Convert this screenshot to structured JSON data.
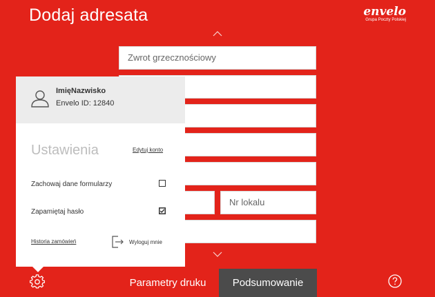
{
  "header": {
    "title": "Dodaj adresata",
    "logo_main": "envelo",
    "logo_sub": "Grupa Poczty Polskiej"
  },
  "form": {
    "title_placeholder": "Zwrot grzecznościowy",
    "apartment_placeholder": "Nr lokalu"
  },
  "settings_panel": {
    "user_name": "ImięNazwisko",
    "envelo_id": "Envelo ID: 12840",
    "title": "Ustawienia",
    "edit_account": "Edytuj konto",
    "option_keep_form": "Zachowaj dane formularzy",
    "option_keep_form_checked": false,
    "option_remember_password": "Zapamiętaj hasło",
    "option_remember_password_checked": true,
    "order_history": "Historia zamówień",
    "logout": "Wyloguj mnie"
  },
  "footer": {
    "print_params": "Parametry druku",
    "summary": "Podsumowanie"
  },
  "colors": {
    "brand_red": "#e3231a",
    "summary_bg": "#4b4b4b",
    "panel_profile_bg": "#ececec"
  },
  "icons": [
    "chevron-up-icon",
    "chevron-down-icon",
    "user-icon",
    "checkbox-icon",
    "logout-icon",
    "gear-icon",
    "help-icon"
  ]
}
